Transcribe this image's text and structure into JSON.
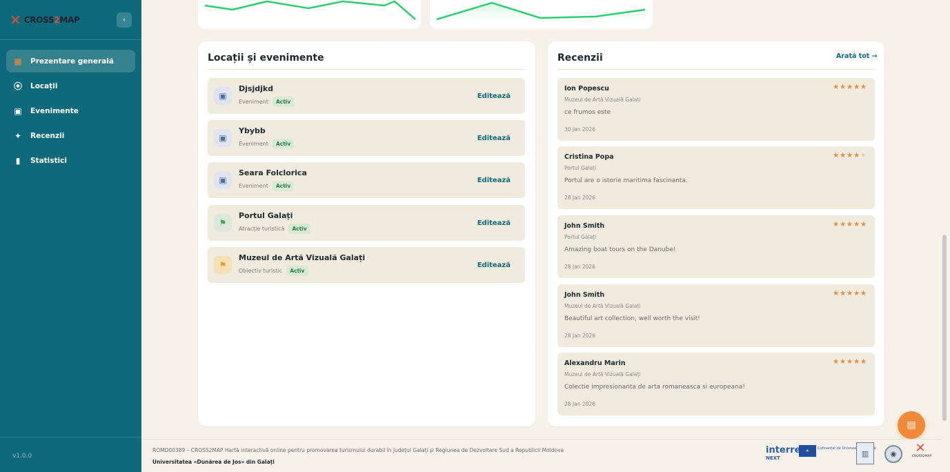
{
  "brand": {
    "logo_part1": "CROSS",
    "logo_part2": "2",
    "logo_part3": "MAP",
    "version": "v1.0.0"
  },
  "sidebar": {
    "collapse_icon": "‹",
    "items": [
      {
        "label": "Prezentare generală",
        "icon": "grid-icon",
        "glyph": "▦",
        "active": true
      },
      {
        "label": "Locații",
        "icon": "map-pin-icon",
        "glyph": "⦿",
        "active": false
      },
      {
        "label": "Evenimente",
        "icon": "calendar-icon",
        "glyph": "▣",
        "active": false
      },
      {
        "label": "Recenzii",
        "icon": "star-box-icon",
        "glyph": "✦",
        "active": false
      },
      {
        "label": "Statistici",
        "icon": "bar-chart-icon",
        "glyph": "▮",
        "active": false
      }
    ]
  },
  "locations": {
    "title": "Locații și evenimente",
    "edit_label": "Editează",
    "badge_label": "Activ",
    "items": [
      {
        "name": "Djsjdjkd",
        "type": "Eveniment",
        "status": "Activ",
        "icon": "calendar-icon",
        "kind": "event"
      },
      {
        "name": "Ybybb",
        "type": "Eveniment",
        "status": "Activ",
        "icon": "calendar-icon",
        "kind": "event"
      },
      {
        "name": "Seara Folclorica",
        "type": "Eveniment",
        "status": "Activ",
        "icon": "calendar-icon",
        "kind": "event"
      },
      {
        "name": "Portul Galați",
        "type": "Atracție turistică",
        "status": "Activ",
        "icon": "flag-icon",
        "kind": "attraction"
      },
      {
        "name": "Muzeul de Artă Vizuală Galați",
        "type": "Obiectiv turistic",
        "status": "Activ",
        "icon": "flag-icon",
        "kind": "objective"
      }
    ]
  },
  "reviews": {
    "title": "Recenzii",
    "show_all": "Arată tot →",
    "items": [
      {
        "author": "Ion Popescu",
        "place": "Muzeul de Artă Vizuală Galați",
        "text": "ce frumos este",
        "date": "30 Jan 2026",
        "rating": 5
      },
      {
        "author": "Cristina Popa",
        "place": "Portul Galați",
        "text": "Portul are o istorie maritima fascinanta.",
        "date": "28 Jan 2026",
        "rating": 4
      },
      {
        "author": "John Smith",
        "place": "Portul Galați",
        "text": "Amazing boat tours on the Danube!",
        "date": "28 Jan 2026",
        "rating": 5
      },
      {
        "author": "John Smith",
        "place": "Muzeul de Artă Vizuală Galați",
        "text": "Beautiful art collection, well worth the visit!",
        "date": "28 Jan 2026",
        "rating": 5
      },
      {
        "author": "Alexandru Marin",
        "place": "Muzeul de Artă Vizuală Galați",
        "text": "Colectie impresionanta de arta romaneasca si europeana!",
        "date": "28 Jan 2026",
        "rating": 5
      }
    ]
  },
  "footer": {
    "line1": "ROMD00389 – CROSS2MAP Hartă interactivă online pentru promovarea turismului durabil în Județul Galați și Regiunea de Dezvoltare Sud a Republicii Moldova",
    "line2": "Universitatea «Dunărea de Jos» din Galați",
    "interreg_word": "interreg",
    "interreg_next": "NEXT",
    "eu_text": "Cofinanțat de Uniunea Europeană",
    "c2m_text": "CROSS2MAP"
  },
  "colors": {
    "primary": "#0e6a7a",
    "accent": "#f08a38",
    "chart_line": "#2ecc71",
    "badge_bg": "#d8ead6"
  }
}
